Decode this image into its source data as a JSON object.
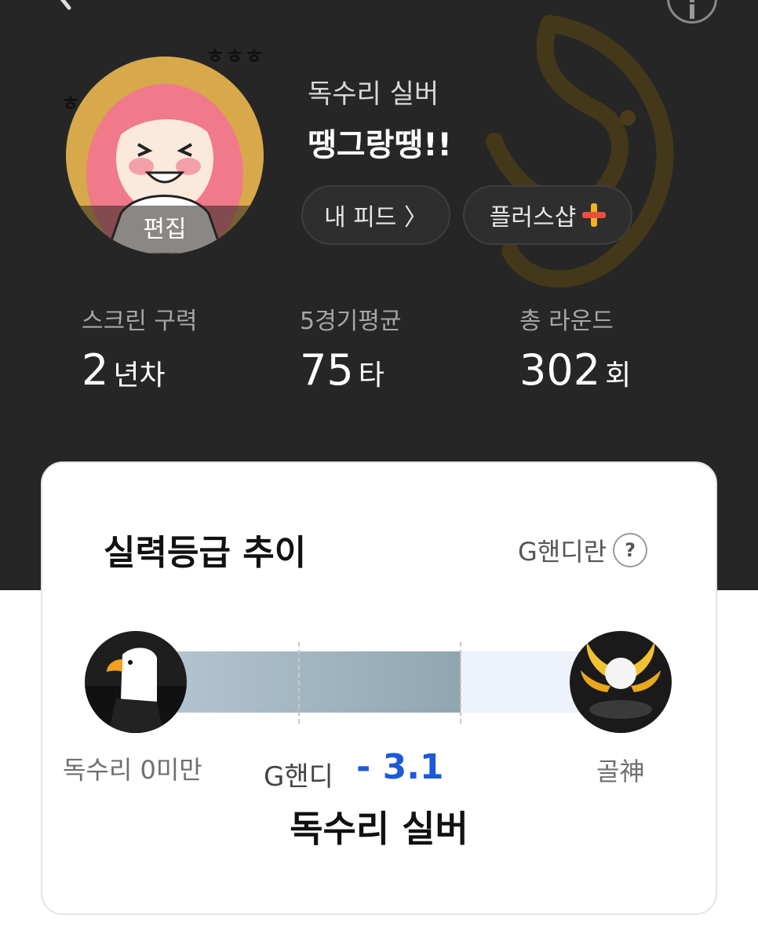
{
  "header": {
    "back_icon": "chevron-left-icon",
    "info_icon": "info-icon"
  },
  "profile": {
    "avatar_edit_label": "편집",
    "doodle_left": "ㅎㅎ",
    "doodle_right": "ㅎㅎㅎ",
    "grade": "독수리 실버",
    "nickname": "땡그랑땡!!",
    "feed_button": "내 피드 〉",
    "plus_shop_button": "플러스샵",
    "plus_icon": "plus-icon"
  },
  "stats": [
    {
      "label": "스크린 구력",
      "value": "2",
      "unit": "년차"
    },
    {
      "label": "5경기평균",
      "value": "75",
      "unit": "타"
    },
    {
      "label": "총 라운드",
      "value": "302",
      "unit": "회"
    }
  ],
  "card": {
    "title": "실력등급 추이",
    "ghandi_link": "G핸디란",
    "help_symbol": "?",
    "scale_left": "독수리 0미만",
    "scale_right": "골神",
    "ghandi_label": "G핸디",
    "ghandi_value": "- 3.1",
    "current_grade": "독수리 실버",
    "progress_fraction": 0.65
  },
  "colors": {
    "top_background": "#262626",
    "accent_gold": "#d7a94a",
    "ghandi_value_blue": "#1d5ad8"
  }
}
